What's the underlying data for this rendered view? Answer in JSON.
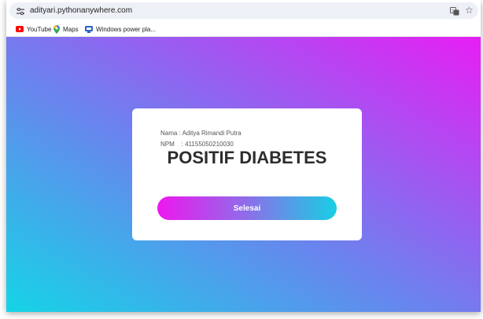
{
  "browser": {
    "url": "adityari.pythonanywhere.com",
    "bookmarks": [
      {
        "label": "YouTube",
        "icon": "youtube-icon"
      },
      {
        "label": "Maps",
        "icon": "maps-pin-icon"
      },
      {
        "label": "Windows power pla...",
        "icon": "windows-power-icon"
      }
    ]
  },
  "card": {
    "name_line": "Nama : Aditya Rimandi Putra",
    "npm_line": "NPM    : 41155050210030",
    "result": "POSITIF DIABETES",
    "button_label": "Selesai"
  },
  "colors": {
    "gradient_cyan": "#15d4e6",
    "gradient_magenta": "#e71ef4",
    "text_dark": "#2d2d2d"
  }
}
